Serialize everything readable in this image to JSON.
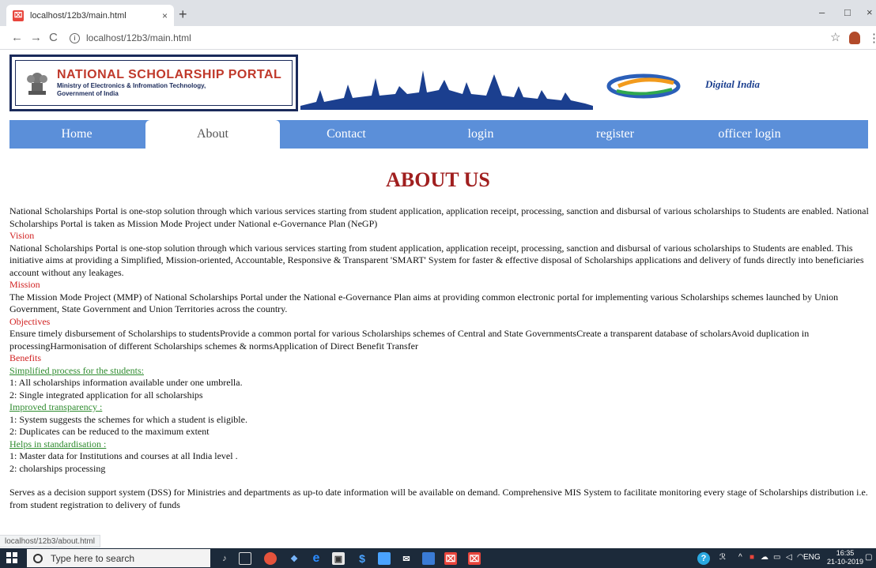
{
  "browser": {
    "tab_title": "localhost/12b3/main.html",
    "tab_close": "×",
    "new_tab": "+",
    "url": "localhost/12b3/main.html",
    "back": "←",
    "forward": "→",
    "reload": "C",
    "minimize": "–",
    "maximize": "□",
    "close": "×",
    "star": "☆",
    "menu": "⋮",
    "status_url": "localhost/12b3/about.html"
  },
  "banner": {
    "portal_title": "NATIONAL SCHOLARSHIP PORTAL",
    "ministry_line1": "Ministry of Electronics & Infromation Technology,",
    "ministry_line2": "Government of India",
    "digital_india": "Digital India"
  },
  "nav": {
    "items": [
      {
        "label": "Home"
      },
      {
        "label": "About"
      },
      {
        "label": "Contact"
      },
      {
        "label": "login"
      },
      {
        "label": "register"
      },
      {
        "label": "officer login"
      }
    ],
    "active": "About"
  },
  "page": {
    "title": "ABOUT US",
    "intro": "National Scholarships Portal is one-stop solution through which various services starting from student application, application receipt, processing, sanction and disbursal of various scholarships to Students are enabled. National Scholarships Portal is taken as Mission Mode Project under National e-Governance Plan (NeGP)",
    "vision_heading": "Vision",
    "vision_text": "National Scholarships Portal is one-stop solution through which various services starting from student application, application receipt, processing, sanction and disbursal of various scholarships to Students are enabled. This initiative aims at providing a Simplified, Mission-oriented, Accountable, Responsive & Transparent 'SMART' System for faster & effective disposal of Scholarships applications and delivery of funds directly into beneficiaries account without any leakages.",
    "mission_heading": "Mission",
    "mission_text": "The Mission Mode Project (MMP) of National Scholarships Portal under the National e-Governance Plan aims at providing common electronic portal for implementing various Scholarships schemes launched by Union Government, State Government and Union Territories across the country.",
    "objectives_heading": "Objectives",
    "objectives_text": "Ensure timely disbursement of Scholarships to studentsProvide a common portal for various Scholarships schemes of Central and State GovernmentsCreate a transparent database of scholarsAvoid duplication in processingHarmonisation of different Scholarships schemes & normsApplication of Direct Benefit Transfer",
    "benefits_heading": "Benefits",
    "benefit_groups": [
      {
        "heading": "Simplified process for the students:",
        "items": [
          "1: All scholarships information available under one umbrella.",
          "2: Single integrated application for all scholarships"
        ]
      },
      {
        "heading": "Improved transparency :",
        "items": [
          "1: System suggests the schemes for which a student is eligible.",
          "2: Duplicates can be reduced to the maximum extent"
        ]
      },
      {
        "heading": "Helps in standardisation :",
        "items": [
          "1: Master data for Institutions and courses at all India level .",
          "2: cholarships processing"
        ]
      }
    ],
    "closing": "Serves as a decision support system (DSS) for Ministries and departments as up-to date information will be available on demand. Comprehensive MIS System to facilitate monitoring every stage of Scholarships distribution i.e. from student registration to delivery of funds"
  },
  "taskbar": {
    "search_placeholder": "Type here to search",
    "tray_lang": "ENG",
    "time": "16:35",
    "date": "21-10-2019"
  }
}
